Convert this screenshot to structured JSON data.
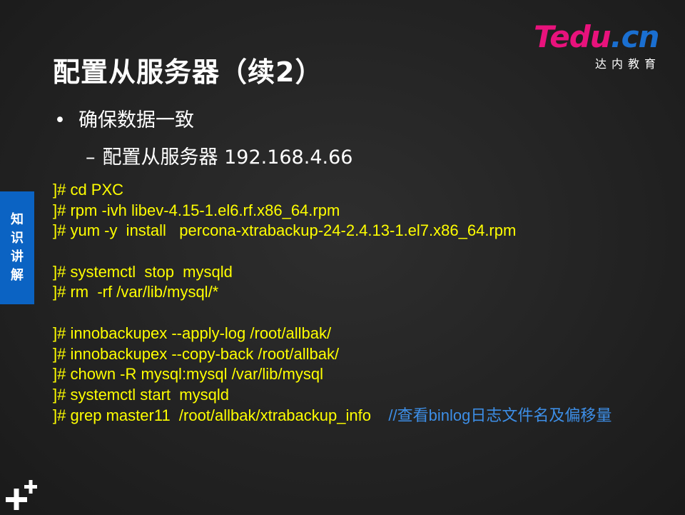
{
  "title": "配置从服务器（续2）",
  "logo": {
    "prefix": "Tedu",
    "suffix": ".cn",
    "subtitle": "达内教育"
  },
  "bullet": "确保数据一致",
  "sub_bullet": "配置从服务器  192.168.4.66",
  "side_tab": {
    "chars": [
      "知",
      "识",
      "讲",
      "解"
    ]
  },
  "code_lines": [
    "]# cd PXC",
    "]# rpm -ivh libev-4.15-1.el6.rf.x86_64.rpm",
    "]# yum -y  install   percona-xtrabackup-24-2.4.13-1.el7.x86_64.rpm",
    "",
    "]# systemctl  stop  mysqld",
    "]# rm  -rf /var/lib/mysql/*",
    "",
    "]# innobackupex --apply-log /root/allbak/",
    "]# innobackupex --copy-back /root/allbak/",
    "]# chown -R mysql:mysql /var/lib/mysql",
    "]# systemctl start  mysqld"
  ],
  "last_line": {
    "command": "]# grep master11  /root/allbak/xtrabackup_info",
    "comment": "//查看binlog日志文件名及偏移量"
  },
  "colors": {
    "background": "#252525",
    "code": "#ffff00",
    "comment": "#3d8ee6",
    "side_tab": "#0b63c3",
    "logo_pink": "#e8127c",
    "logo_blue": "#1a6fd1"
  },
  "icons": {
    "bottom_left": "plus-plus-icon"
  }
}
